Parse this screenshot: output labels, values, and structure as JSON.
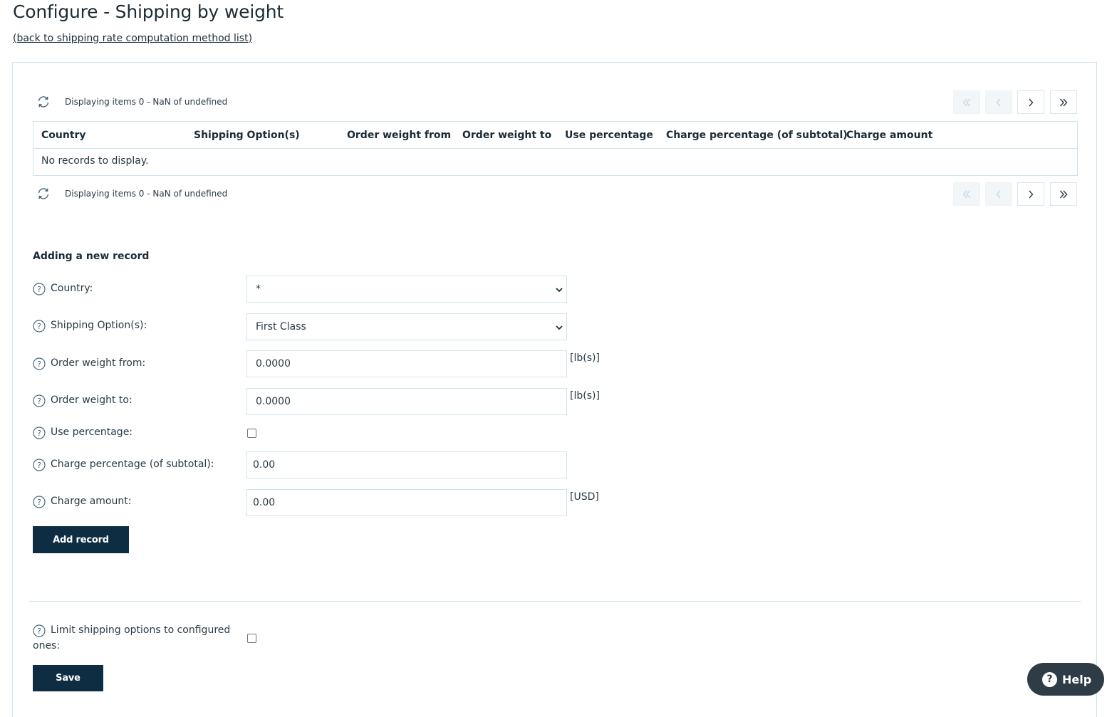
{
  "page": {
    "title": "Configure - Shipping by weight",
    "back_link": "(back to shipping rate computation method list)"
  },
  "grid": {
    "pager_info_top": "Displaying items 0 - NaN of undefined",
    "pager_info_bottom": "Displaying items 0 - NaN of undefined",
    "columns": [
      "Country",
      "Shipping Option(s)",
      "Order weight from",
      "Order weight to",
      "Use percentage",
      "Charge percentage (of subtotal)",
      "Charge amount"
    ],
    "empty_message": "No records to display."
  },
  "form": {
    "section_title": "Adding a new record",
    "country": {
      "label": "Country:",
      "value": "*"
    },
    "shipping_option": {
      "label": "Shipping Option(s):",
      "value": "First Class"
    },
    "weight_from": {
      "label": "Order weight from:",
      "value": "0.0000",
      "unit": "[lb(s)]"
    },
    "weight_to": {
      "label": "Order weight to:",
      "value": "0.0000",
      "unit": "[lb(s)]"
    },
    "use_percentage": {
      "label": "Use percentage:",
      "checked": false
    },
    "charge_percentage": {
      "label": "Charge percentage (of subtotal):",
      "value": "0.00"
    },
    "charge_amount": {
      "label": "Charge amount:",
      "value": "0.00",
      "unit": "[USD]"
    },
    "add_button": "Add record"
  },
  "settings": {
    "limit_label_line1": "Limit shipping options to configured",
    "limit_label_line2": "ones:",
    "limit_checked": false,
    "save_button": "Save"
  },
  "help_button": {
    "icon": "?",
    "label": "Help"
  },
  "colors": {
    "primary_dark": "#0e2d42",
    "border": "#cfe3ee",
    "help_fab": "#2e3c47"
  }
}
